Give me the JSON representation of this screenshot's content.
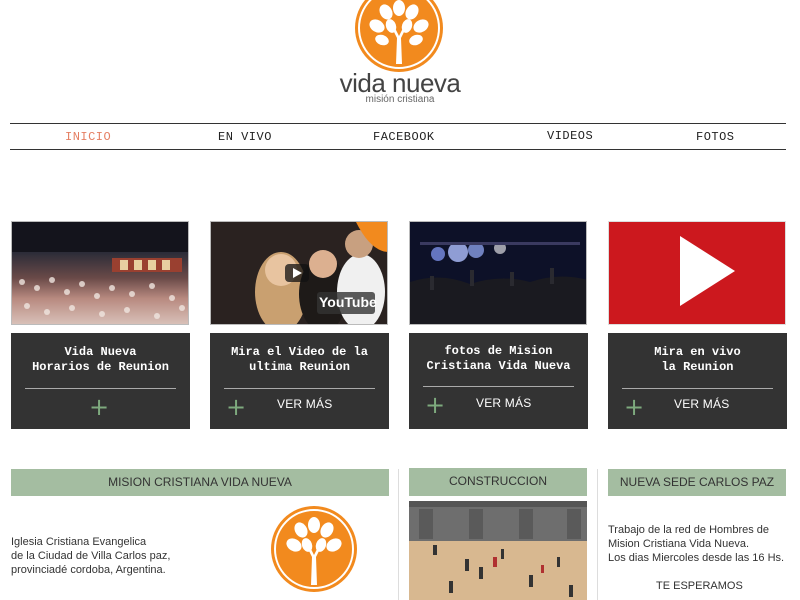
{
  "brand": {
    "name": "vida nueva",
    "subtitle": "misión cristiana"
  },
  "nav": {
    "items": [
      "INICIO",
      "EN VIVO",
      "FACEBOOK",
      "VIDEOS",
      "FOTOS"
    ],
    "active": "INICIO"
  },
  "cards": [
    {
      "title": "Vida Nueva\nHorarios de Reunion",
      "more": ""
    },
    {
      "title": "Mira el Video de la\nultima Reunion",
      "more": "VER MÁS"
    },
    {
      "title": "fotos de Mision\nCristiana Vida Nueva",
      "more": "VER MÁS"
    },
    {
      "title": "Mira en vivo\nla Reunion",
      "more": "VER MÁS"
    }
  ],
  "thumb_video": {
    "badge": "YouTube"
  },
  "sections": {
    "mision": {
      "heading": "MISION CRISTIANA VIDA NUEVA",
      "text": "Iglesia Cristiana Evangelica\nde la Ciudad de Villa Carlos paz,\nprovinciadé cordoba, Argentina."
    },
    "construccion": {
      "heading": "CONSTRUCCION"
    },
    "sede": {
      "heading": "NUEVA SEDE CARLOS PAZ",
      "text": "Trabajo de la red de Hombres de\nMision Cristiana Vida Nueva.\nLos dias Miercoles desde las 16 Hs.",
      "cta": "TE ESPERAMOS"
    }
  },
  "colors": {
    "accent_orange": "#f28a1e",
    "nav_active": "#e57f63",
    "card_bg": "#333333",
    "section_head": "#a4bda1",
    "youtube_red": "#cc181e",
    "plus_green": "#7eaa7e"
  }
}
